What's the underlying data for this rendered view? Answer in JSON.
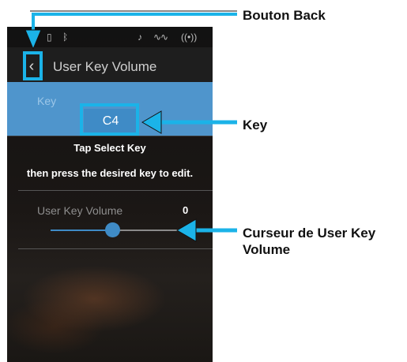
{
  "status_bar": {
    "icons": [
      "usb-icon",
      "bluetooth-icon",
      "midi-icon",
      "sound-wave-icon",
      "wireless-icon"
    ]
  },
  "header": {
    "title": "User Key Volume",
    "back_icon": "‹"
  },
  "key_section": {
    "label": "Key",
    "key_button_label": "C4"
  },
  "instructions": {
    "line1": "Tap Select Key",
    "line2": "then press the desired key to edit."
  },
  "slider": {
    "label": "User Key Volume",
    "value": "0",
    "fill_fraction": 0.5
  },
  "callouts": {
    "back": "Bouton Back",
    "key": "Key",
    "slider": "Curseur de User Key Volume"
  },
  "colors": {
    "accent": "#3f8bc6",
    "callout": "#1bb3e8",
    "key_panel": "#4f95cc"
  }
}
